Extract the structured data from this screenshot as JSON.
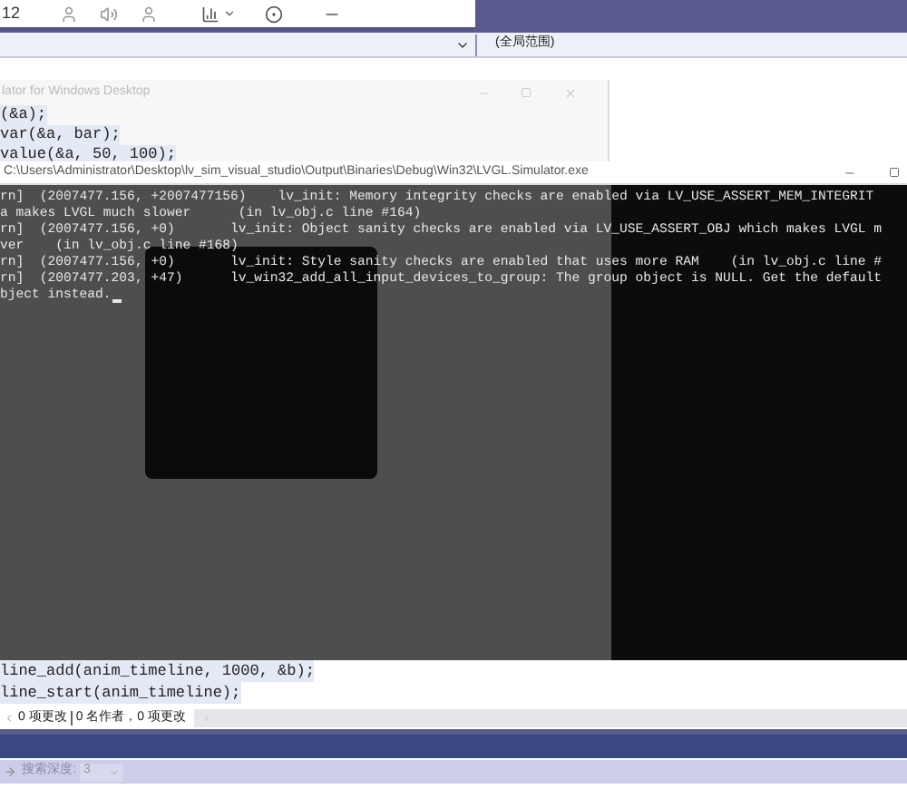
{
  "popup": {
    "text": "12"
  },
  "editor": {
    "scope": "(全局范围)",
    "code_top": [
      "(&a);",
      "var(&a, bar);",
      "value(&a, 50, 100);"
    ],
    "code_bottom": [
      "line_add(anim_timeline, 1000, &b);",
      "line_start(anim_timeline);"
    ]
  },
  "ghost_window": {
    "title": "lator for Windows Desktop"
  },
  "console": {
    "title": "C:\\Users\\Administrator\\Desktop\\lv_sim_visual_studio\\Output\\Binaries\\Debug\\Win32\\LVGL.Simulator.exe",
    "lines": [
      "rn]  (2007477.156, +2007477156)    lv_init: Memory integrity checks are enabled via LV_USE_ASSERT_MEM_INTEGRIT",
      "a makes LVGL much slower      (in lv_obj.c line #164)",
      "rn]  (2007477.156, +0)       lv_init: Object sanity checks are enabled via LV_USE_ASSERT_OBJ which makes LVGL m",
      "ver    (in lv_obj.c line #168)",
      "rn]  (2007477.156, +0)       lv_init: Style sanity checks are enabled that uses more RAM    (in lv_obj.c line #",
      "rn]  (2007477.203, +47)      lv_win32_add_all_input_devices_to_group: The group object is NULL. Get the default",
      "bject instead."
    ]
  },
  "status": {
    "changes": "0 项更改",
    "authors": "0 名作者，0 项更改"
  },
  "search": {
    "label": "搜索深度:",
    "value": "3"
  }
}
